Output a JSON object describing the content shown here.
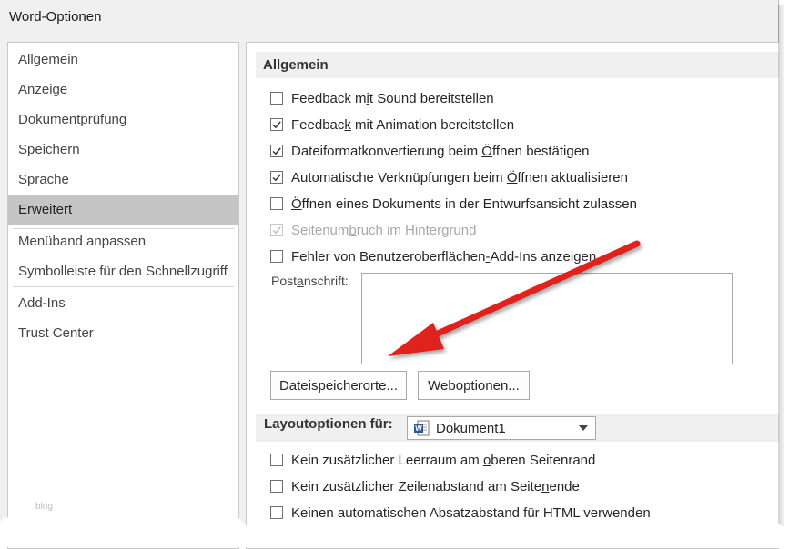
{
  "window": {
    "title": "Word-Optionen"
  },
  "sidebar": {
    "items": [
      {
        "label": "Allgemein",
        "selected": false
      },
      {
        "label": "Anzeige",
        "selected": false
      },
      {
        "label": "Dokumentprüfung",
        "selected": false
      },
      {
        "label": "Speichern",
        "selected": false
      },
      {
        "label": "Sprache",
        "selected": false
      },
      {
        "label": "Erweitert",
        "selected": true
      },
      {
        "label": "Menüband anpassen",
        "selected": false
      },
      {
        "label": "Symbolleiste für den Schnellzugriff",
        "selected": false
      },
      {
        "label": "Add-Ins",
        "selected": false
      },
      {
        "label": "Trust Center",
        "selected": false
      }
    ],
    "watermark": "blog"
  },
  "general": {
    "header": "Allgemein",
    "options": [
      {
        "label": "Feedback mit Sound bereitstellen",
        "checked": false,
        "enabled": true
      },
      {
        "label": "Feedback mit Animation bereitstellen",
        "checked": true,
        "enabled": true
      },
      {
        "label": "Dateiformatkonvertierung beim Öffnen bestätigen",
        "checked": true,
        "enabled": true
      },
      {
        "label": "Automatische Verknüpfungen beim Öffnen aktualisieren",
        "checked": true,
        "enabled": true
      },
      {
        "label": "Öffnen eines Dokuments in der Entwurfsansicht zulassen",
        "checked": false,
        "enabled": true
      },
      {
        "label": "Seitenumbruch im Hintergrund",
        "checked": true,
        "enabled": false
      },
      {
        "label": "Fehler von Benutzeroberflächen-Add-Ins anzeigen",
        "checked": false,
        "enabled": true
      }
    ],
    "address_label": "Postanschrift:",
    "address_value": "",
    "buttons": {
      "file_locations": "Dateispeicherorte...",
      "web_options": "Weboptionen..."
    }
  },
  "layout": {
    "label": "Layoutoptionen für:",
    "document": "Dokument1",
    "document_icon": "word-document-icon",
    "options": [
      {
        "label": "Kein zusätzlicher Leerraum am oberen Seitenrand",
        "checked": false
      },
      {
        "label": "Kein zusätzlicher Zeilenabstand am Seitenende",
        "checked": false
      },
      {
        "label": "Keinen automatischen Absatzabstand für HTML verwenden",
        "checked": false
      }
    ]
  },
  "annotation": {
    "arrow_color": "#e0201c"
  },
  "colors": {
    "selected_nav": "#c5c5c5",
    "section_header_bg": "#f0f0f0",
    "checkmark": "#333333"
  }
}
